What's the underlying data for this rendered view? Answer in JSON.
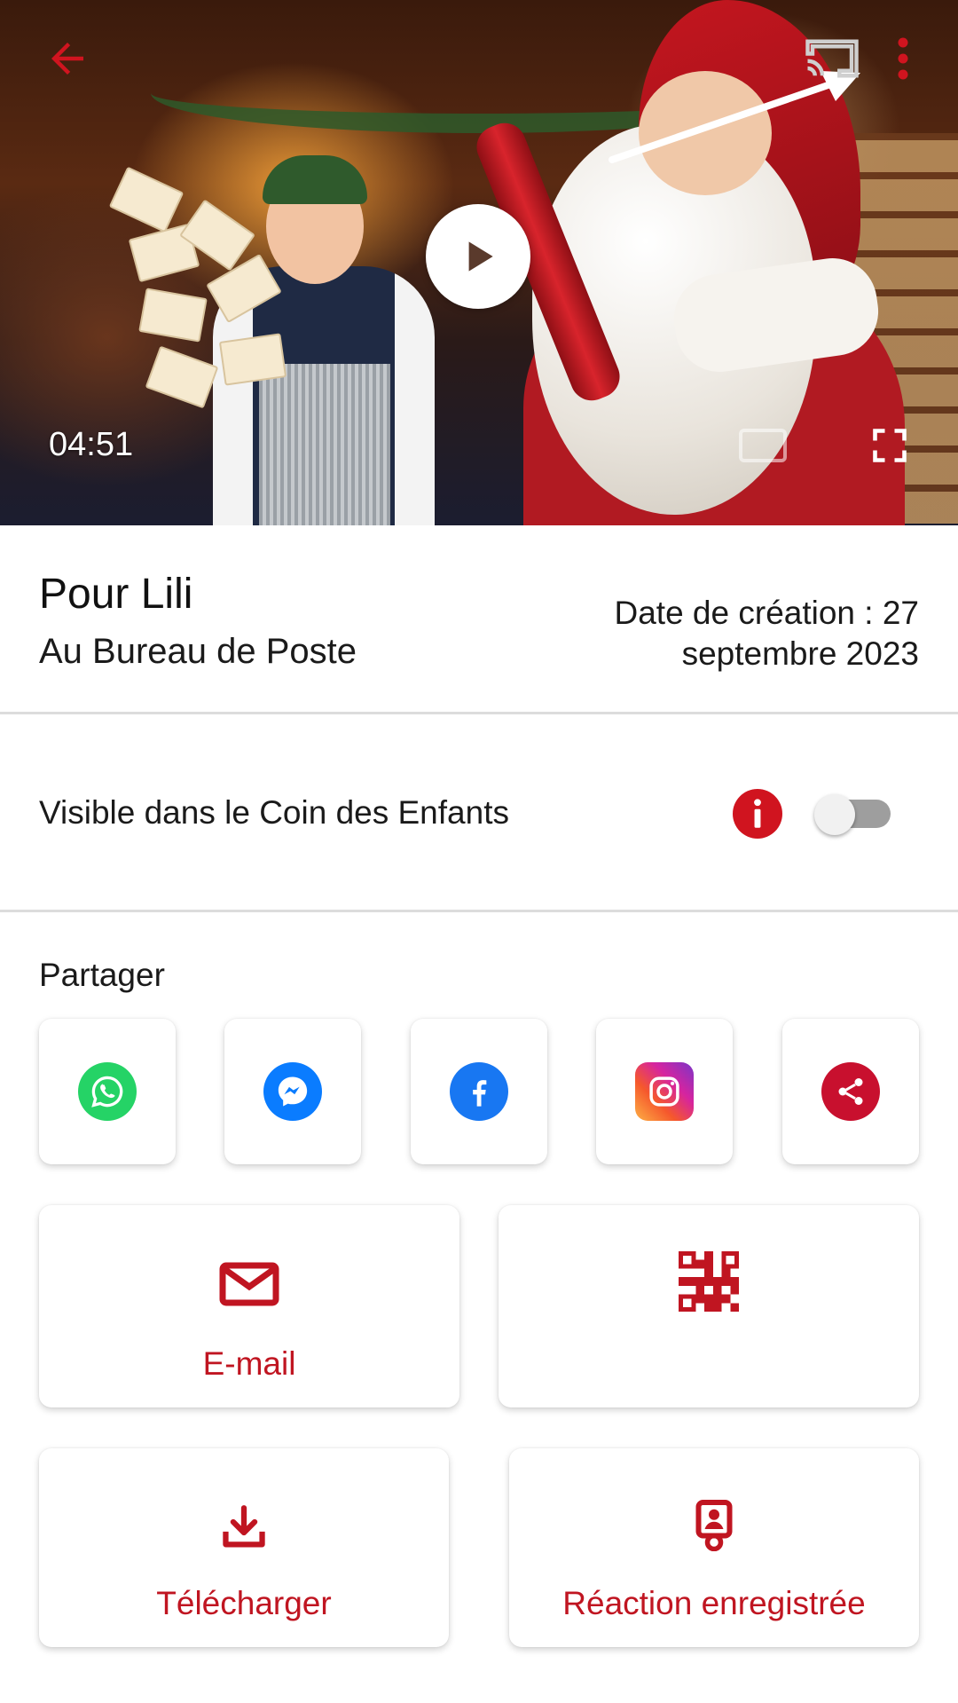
{
  "video": {
    "duration": "04:51"
  },
  "info": {
    "title": "Pour Lili",
    "subtitle": "Au Bureau de Poste",
    "created_line1": "Date de création : 27",
    "created_line2": "septembre 2023"
  },
  "visibility": {
    "label": "Visible dans le Coin des Enfants",
    "toggle_on": false
  },
  "share": {
    "heading": "Partager",
    "apps": [
      "whatsapp-icon",
      "messenger-icon",
      "facebook-icon",
      "instagram-icon",
      "share-icon"
    ]
  },
  "actions": {
    "email_label": "E-mail",
    "download_label": "Télécharger",
    "reaction_label": "Réaction enregistrée"
  },
  "colors": {
    "accent": "#c01521",
    "whatsapp": "#25d366",
    "messenger": "#0a7cff",
    "facebook": "#1877f2"
  }
}
